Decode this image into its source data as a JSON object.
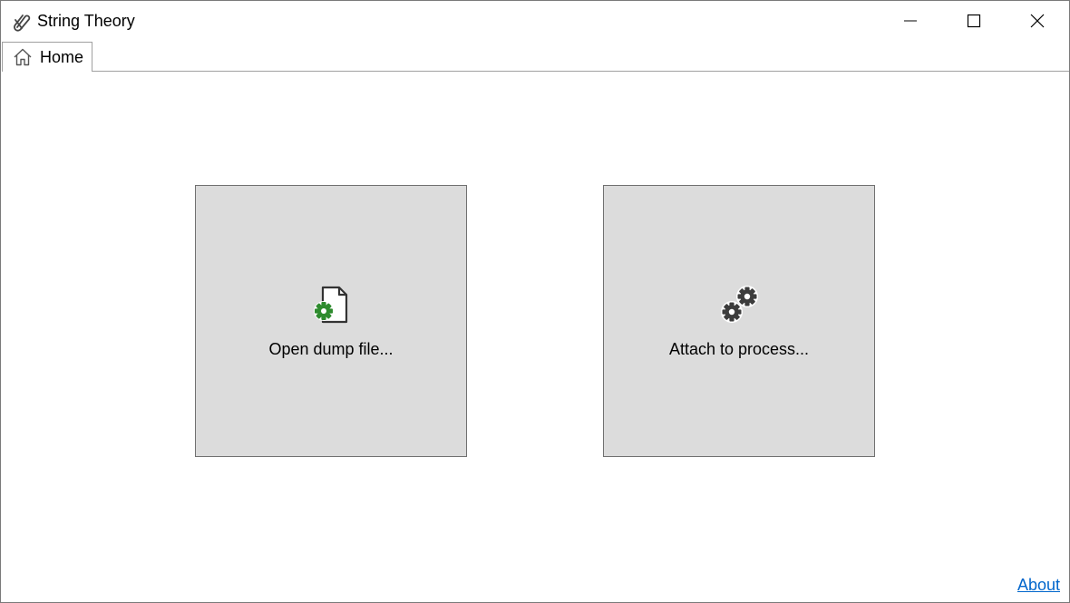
{
  "window": {
    "title": "String Theory",
    "app_icon": "paperclip-icon"
  },
  "caption_buttons": {
    "minimize_icon": "minimize-icon",
    "maximize_icon": "maximize-icon",
    "close_icon": "close-icon"
  },
  "tabs": [
    {
      "label": "Home",
      "icon": "home-icon",
      "active": true
    }
  ],
  "tiles": [
    {
      "label": "Open dump file...",
      "icon": "document-gear-icon",
      "accent": "#2e8b2e"
    },
    {
      "label": "Attach to process...",
      "icon": "gears-icon",
      "accent": "#3c3c3c"
    }
  ],
  "footer": {
    "about_label": "About"
  },
  "colors": {
    "tile_background": "#dcdcdc",
    "link": "#0066cc"
  }
}
